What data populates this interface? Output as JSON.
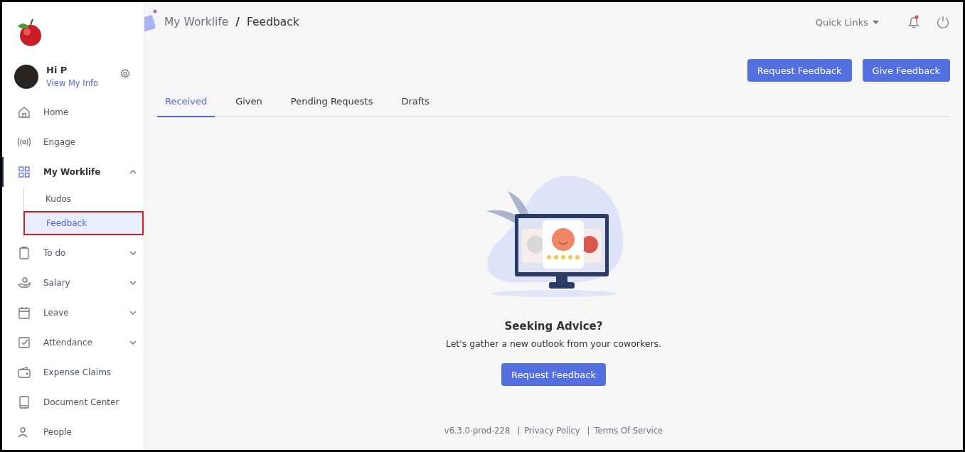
{
  "user": {
    "greeting": "Hi P",
    "link": "View My Info"
  },
  "nav": [
    {
      "label": "Home",
      "selected": false
    },
    {
      "label": "Engage",
      "selected": false
    },
    {
      "label": "My Worklife",
      "selected": true,
      "expanded": true,
      "children": [
        {
          "label": "Kudos",
          "selected": false
        },
        {
          "label": "Feedback",
          "selected": true
        }
      ]
    },
    {
      "label": "To do",
      "selected": false,
      "expanded": false
    },
    {
      "label": "Salary",
      "selected": false,
      "expanded": false
    },
    {
      "label": "Leave",
      "selected": false,
      "expanded": false
    },
    {
      "label": "Attendance",
      "selected": false,
      "expanded": false
    },
    {
      "label": "Expense Claims",
      "selected": false
    },
    {
      "label": "Document Center",
      "selected": false
    },
    {
      "label": "People",
      "selected": false
    }
  ],
  "breadcrumb": [
    "My Worklife",
    "/",
    "Feedback"
  ],
  "quick_links": "Quick Links",
  "notifications": {
    "unread": true
  },
  "actions": [
    "Request Feedback",
    "Give Feedback"
  ],
  "tabs": [
    {
      "label": "Received",
      "selected": true
    },
    {
      "label": "Given",
      "selected": false
    },
    {
      "label": "Pending Requests",
      "selected": false
    },
    {
      "label": "Drafts",
      "selected": false
    }
  ],
  "empty_state": {
    "title": "Seeking Advice?",
    "message": "Let's gather a new outlook from your coworkers.",
    "button": "Request Feedback"
  },
  "footer": {
    "version": "v6.3.0-prod-228",
    "items": [
      {
        "separator": "|",
        "link": "Privacy Policy"
      },
      {
        "separator": "|",
        "link": "Terms Of Service"
      }
    ]
  }
}
